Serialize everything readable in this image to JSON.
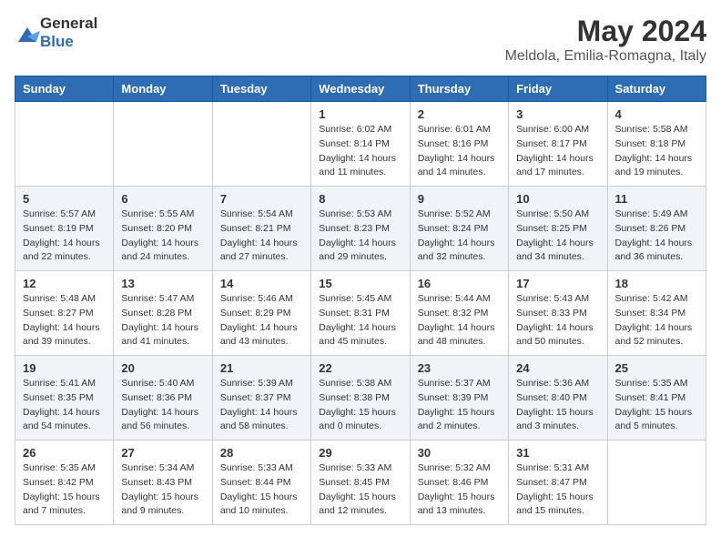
{
  "logo": {
    "general": "General",
    "blue": "Blue"
  },
  "title": "May 2024",
  "location": "Meldola, Emilia-Romagna, Italy",
  "headers": [
    "Sunday",
    "Monday",
    "Tuesday",
    "Wednesday",
    "Thursday",
    "Friday",
    "Saturday"
  ],
  "weeks": [
    [
      {
        "day": "",
        "sunrise": "",
        "sunset": "",
        "daylight": ""
      },
      {
        "day": "",
        "sunrise": "",
        "sunset": "",
        "daylight": ""
      },
      {
        "day": "",
        "sunrise": "",
        "sunset": "",
        "daylight": ""
      },
      {
        "day": "1",
        "sunrise": "Sunrise: 6:02 AM",
        "sunset": "Sunset: 8:14 PM",
        "daylight": "Daylight: 14 hours and 11 minutes."
      },
      {
        "day": "2",
        "sunrise": "Sunrise: 6:01 AM",
        "sunset": "Sunset: 8:16 PM",
        "daylight": "Daylight: 14 hours and 14 minutes."
      },
      {
        "day": "3",
        "sunrise": "Sunrise: 6:00 AM",
        "sunset": "Sunset: 8:17 PM",
        "daylight": "Daylight: 14 hours and 17 minutes."
      },
      {
        "day": "4",
        "sunrise": "Sunrise: 5:58 AM",
        "sunset": "Sunset: 8:18 PM",
        "daylight": "Daylight: 14 hours and 19 minutes."
      }
    ],
    [
      {
        "day": "5",
        "sunrise": "Sunrise: 5:57 AM",
        "sunset": "Sunset: 8:19 PM",
        "daylight": "Daylight: 14 hours and 22 minutes."
      },
      {
        "day": "6",
        "sunrise": "Sunrise: 5:55 AM",
        "sunset": "Sunset: 8:20 PM",
        "daylight": "Daylight: 14 hours and 24 minutes."
      },
      {
        "day": "7",
        "sunrise": "Sunrise: 5:54 AM",
        "sunset": "Sunset: 8:21 PM",
        "daylight": "Daylight: 14 hours and 27 minutes."
      },
      {
        "day": "8",
        "sunrise": "Sunrise: 5:53 AM",
        "sunset": "Sunset: 8:23 PM",
        "daylight": "Daylight: 14 hours and 29 minutes."
      },
      {
        "day": "9",
        "sunrise": "Sunrise: 5:52 AM",
        "sunset": "Sunset: 8:24 PM",
        "daylight": "Daylight: 14 hours and 32 minutes."
      },
      {
        "day": "10",
        "sunrise": "Sunrise: 5:50 AM",
        "sunset": "Sunset: 8:25 PM",
        "daylight": "Daylight: 14 hours and 34 minutes."
      },
      {
        "day": "11",
        "sunrise": "Sunrise: 5:49 AM",
        "sunset": "Sunset: 8:26 PM",
        "daylight": "Daylight: 14 hours and 36 minutes."
      }
    ],
    [
      {
        "day": "12",
        "sunrise": "Sunrise: 5:48 AM",
        "sunset": "Sunset: 8:27 PM",
        "daylight": "Daylight: 14 hours and 39 minutes."
      },
      {
        "day": "13",
        "sunrise": "Sunrise: 5:47 AM",
        "sunset": "Sunset: 8:28 PM",
        "daylight": "Daylight: 14 hours and 41 minutes."
      },
      {
        "day": "14",
        "sunrise": "Sunrise: 5:46 AM",
        "sunset": "Sunset: 8:29 PM",
        "daylight": "Daylight: 14 hours and 43 minutes."
      },
      {
        "day": "15",
        "sunrise": "Sunrise: 5:45 AM",
        "sunset": "Sunset: 8:31 PM",
        "daylight": "Daylight: 14 hours and 45 minutes."
      },
      {
        "day": "16",
        "sunrise": "Sunrise: 5:44 AM",
        "sunset": "Sunset: 8:32 PM",
        "daylight": "Daylight: 14 hours and 48 minutes."
      },
      {
        "day": "17",
        "sunrise": "Sunrise: 5:43 AM",
        "sunset": "Sunset: 8:33 PM",
        "daylight": "Daylight: 14 hours and 50 minutes."
      },
      {
        "day": "18",
        "sunrise": "Sunrise: 5:42 AM",
        "sunset": "Sunset: 8:34 PM",
        "daylight": "Daylight: 14 hours and 52 minutes."
      }
    ],
    [
      {
        "day": "19",
        "sunrise": "Sunrise: 5:41 AM",
        "sunset": "Sunset: 8:35 PM",
        "daylight": "Daylight: 14 hours and 54 minutes."
      },
      {
        "day": "20",
        "sunrise": "Sunrise: 5:40 AM",
        "sunset": "Sunset: 8:36 PM",
        "daylight": "Daylight: 14 hours and 56 minutes."
      },
      {
        "day": "21",
        "sunrise": "Sunrise: 5:39 AM",
        "sunset": "Sunset: 8:37 PM",
        "daylight": "Daylight: 14 hours and 58 minutes."
      },
      {
        "day": "22",
        "sunrise": "Sunrise: 5:38 AM",
        "sunset": "Sunset: 8:38 PM",
        "daylight": "Daylight: 15 hours and 0 minutes."
      },
      {
        "day": "23",
        "sunrise": "Sunrise: 5:37 AM",
        "sunset": "Sunset: 8:39 PM",
        "daylight": "Daylight: 15 hours and 2 minutes."
      },
      {
        "day": "24",
        "sunrise": "Sunrise: 5:36 AM",
        "sunset": "Sunset: 8:40 PM",
        "daylight": "Daylight: 15 hours and 3 minutes."
      },
      {
        "day": "25",
        "sunrise": "Sunrise: 5:35 AM",
        "sunset": "Sunset: 8:41 PM",
        "daylight": "Daylight: 15 hours and 5 minutes."
      }
    ],
    [
      {
        "day": "26",
        "sunrise": "Sunrise: 5:35 AM",
        "sunset": "Sunset: 8:42 PM",
        "daylight": "Daylight: 15 hours and 7 minutes."
      },
      {
        "day": "27",
        "sunrise": "Sunrise: 5:34 AM",
        "sunset": "Sunset: 8:43 PM",
        "daylight": "Daylight: 15 hours and 9 minutes."
      },
      {
        "day": "28",
        "sunrise": "Sunrise: 5:33 AM",
        "sunset": "Sunset: 8:44 PM",
        "daylight": "Daylight: 15 hours and 10 minutes."
      },
      {
        "day": "29",
        "sunrise": "Sunrise: 5:33 AM",
        "sunset": "Sunset: 8:45 PM",
        "daylight": "Daylight: 15 hours and 12 minutes."
      },
      {
        "day": "30",
        "sunrise": "Sunrise: 5:32 AM",
        "sunset": "Sunset: 8:46 PM",
        "daylight": "Daylight: 15 hours and 13 minutes."
      },
      {
        "day": "31",
        "sunrise": "Sunrise: 5:31 AM",
        "sunset": "Sunset: 8:47 PM",
        "daylight": "Daylight: 15 hours and 15 minutes."
      },
      {
        "day": "",
        "sunrise": "",
        "sunset": "",
        "daylight": ""
      }
    ]
  ]
}
